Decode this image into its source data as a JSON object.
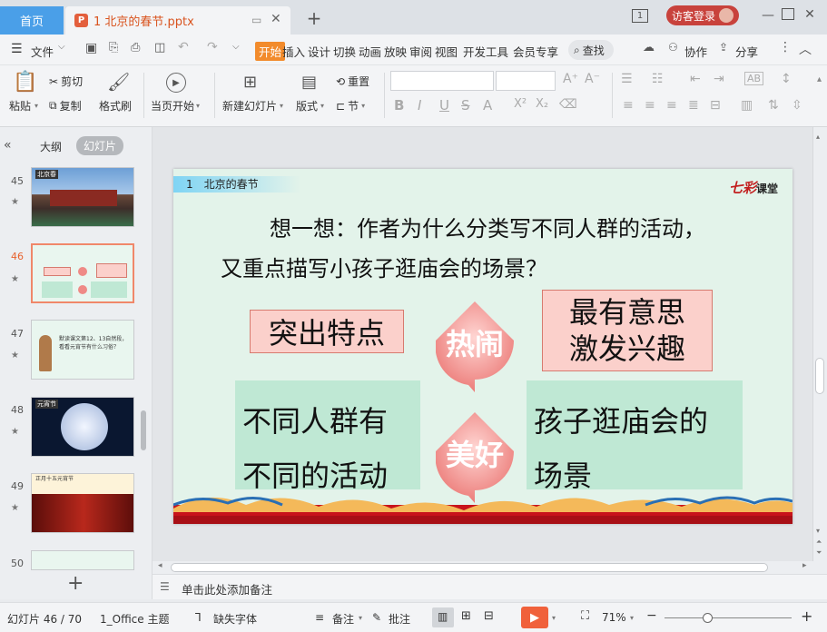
{
  "titlebar": {
    "home_tab": "首页",
    "doc_tab": "1 北京的春节.pptx",
    "doc_badge": "P",
    "page_indicator": "1",
    "login_label": "访客登录"
  },
  "menubar": {
    "file": "文件",
    "items": [
      "开始",
      "插入",
      "设计",
      "切换",
      "动画",
      "放映",
      "审阅",
      "视图",
      "开发工具",
      "会员专享"
    ],
    "active": "开始",
    "search": "查找",
    "collab": "协作",
    "share": "分享"
  },
  "ribbon": {
    "paste": "粘贴",
    "cut": "剪切",
    "copy": "复制",
    "format_painter": "格式刷",
    "start_from_current": "当页开始",
    "new_slide": "新建幻灯片",
    "layout": "版式",
    "reset": "重置",
    "section": "节"
  },
  "left_panel": {
    "outline_tab": "大纲",
    "slides_tab": "幻灯片",
    "thumbs": [
      {
        "num": "45",
        "caption": "北京春"
      },
      {
        "num": "46",
        "caption": ""
      },
      {
        "num": "47",
        "caption": "默读课文第12、13自然段，看看元宵节有什么习俗？"
      },
      {
        "num": "48",
        "caption": "元宵节"
      },
      {
        "num": "49",
        "caption": "正月十五元宵节"
      },
      {
        "num": "50",
        "caption": ""
      }
    ],
    "add_slide": "+"
  },
  "slide": {
    "header": "1　北京的春节",
    "logo_main": "七彩",
    "logo_sub": "课堂",
    "question_line1": "想一想：作者为什么分类写不同人群的活动，",
    "question_line2": "又重点描写小孩子逛庙会的场景？",
    "box_top_left": "突出特点",
    "box_top_right_line1": "最有意思",
    "box_top_right_line2": "激发兴趣",
    "drop_top": "热闹",
    "drop_bottom": "美好",
    "box_bottom_left_line1": "不同人群有",
    "box_bottom_left_line2": "不同的活动",
    "box_bottom_right_line1": "孩子逛庙会的",
    "box_bottom_right_line2": "场景"
  },
  "notes": {
    "placeholder": "单击此处添加备注"
  },
  "statusbar": {
    "slide_info": "幻灯片 46 / 70",
    "theme": "1_Office 主题",
    "missing_font": "缺失字体",
    "notes_btn": "备注",
    "comments_btn": "批注",
    "zoom": "71%"
  },
  "colors": {
    "accent_orange": "#f28b2c",
    "home_blue": "#4a9fe8",
    "login_red": "#c8423c",
    "play_orange": "#f0613b"
  }
}
